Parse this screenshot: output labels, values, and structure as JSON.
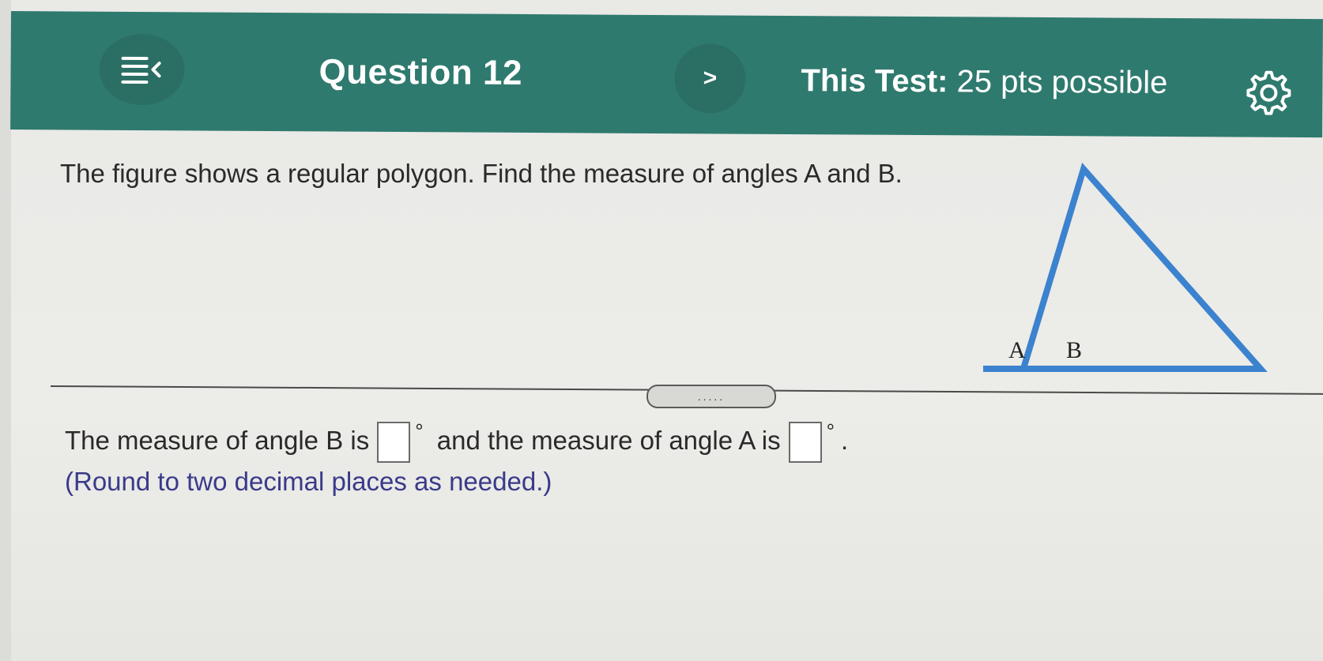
{
  "header": {
    "menu_icon": "menu-collapse-icon",
    "question_title": "Question 12",
    "next_label": ">",
    "test_label": "This Test:",
    "test_points": "25 pts possible",
    "settings_icon": "gear-icon",
    "bar_color": "#2f7a6e"
  },
  "question": {
    "text": "The figure shows a regular polygon. Find the measure of angles A and B.",
    "figure": {
      "shape": "triangle",
      "label_a": "A",
      "label_b": "B",
      "stroke_color": "#3b82cf"
    }
  },
  "divider": {
    "handle_label": "....."
  },
  "answer": {
    "part1": "The measure of angle B is",
    "degree": "°",
    "part2": "and the measure of angle A is",
    "end": ".",
    "box_b_value": "",
    "box_a_value": "",
    "note": "(Round to two decimal places as needed.)"
  }
}
